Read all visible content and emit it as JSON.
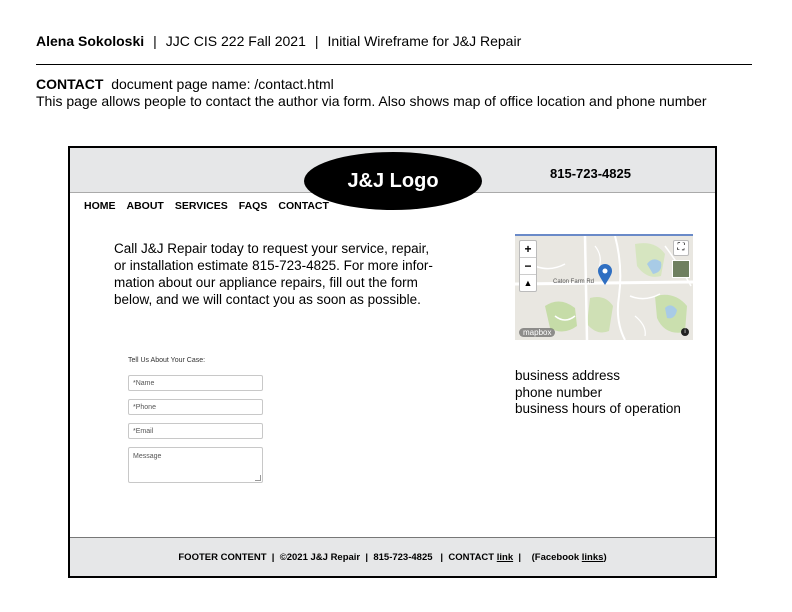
{
  "doc": {
    "author": "Alena Sokoloski",
    "course": "JJC CIS 222 Fall 2021",
    "title": "Initial Wireframe for J&J Repair",
    "separator": "|",
    "page_label": "CONTACT",
    "page_name": "document page name: /contact.html",
    "description": "This page allows people to contact the author via form. Also shows map of office location and phone number"
  },
  "site": {
    "logo": "J&J Logo",
    "phone": "815-723-4825",
    "nav": [
      "HOME",
      "ABOUT",
      "SERVICES",
      "FAQS",
      "CONTACT"
    ],
    "intro_lines": [
      "Call J&J Repair today to request your service, repair,",
      "or installation estimate 815-723-4825. For more infor-",
      "mation about our appliance repairs, fill out the form",
      "below, and we will contact you as soon as possible."
    ],
    "map": {
      "zoom_in": "+",
      "zoom_out": "−",
      "road_label": "Caton Farm Rd",
      "attribution": "mapbox",
      "info": "i",
      "expand_icon": "expand-icon",
      "pin_color": "#2f6fc2"
    },
    "business_info": [
      "business address",
      "phone number",
      "business hours of operation"
    ],
    "form": {
      "title": "Tell Us About Your Case:",
      "name_placeholder": "*Name",
      "phone_placeholder": "*Phone",
      "email_placeholder": "*Email",
      "message_placeholder": "Message"
    },
    "footer": {
      "part1": "FOOTER CONTENT  |  ©2021 J&J Repair  |  815-723-4825   |  CONTACT ",
      "contact_link": "link",
      "part2": "  |    (Facebook ",
      "facebook_link": "links",
      "part3": ")"
    }
  }
}
